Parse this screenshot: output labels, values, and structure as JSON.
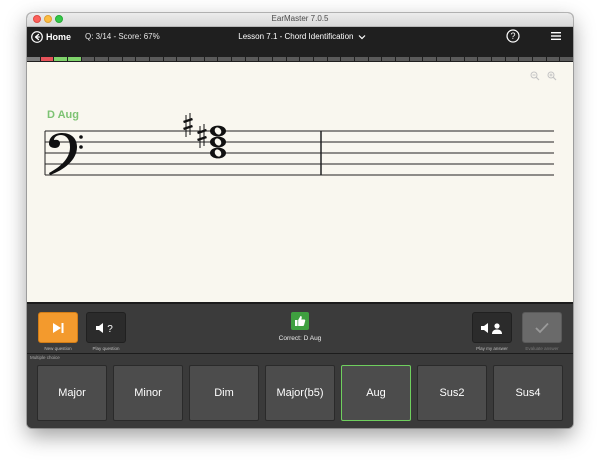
{
  "window": {
    "title": "EarMaster 7.0.5"
  },
  "header": {
    "home_label": "Home",
    "score_text": "Q: 3/14 - Score: 67%",
    "lesson_title": "Lesson 7.1 - Chord Identification",
    "progress": {
      "total": 40,
      "wrong": [
        1
      ],
      "current": [
        2,
        3
      ],
      "done": [
        0
      ]
    }
  },
  "exercise": {
    "chord_label": "D Aug",
    "clef": "bass",
    "chord_notes": [
      "D",
      "F#",
      "A#"
    ]
  },
  "controls": {
    "new_question_caption": "New question",
    "play_question_caption": "Play question",
    "feedback_text": "Correct: D Aug",
    "play_answer_caption": "Play my answer",
    "evaluate_caption": "Evaluate answer"
  },
  "answers": {
    "label": "Multiple choice",
    "options": [
      "Major",
      "Minor",
      "Dim",
      "Major(b5)",
      "Aug",
      "Sus2",
      "Sus4"
    ],
    "selected": "Aug"
  },
  "colors": {
    "accent_green": "#7dc373",
    "orange": "#f39a2d",
    "wrong_red": "#e6535a"
  }
}
